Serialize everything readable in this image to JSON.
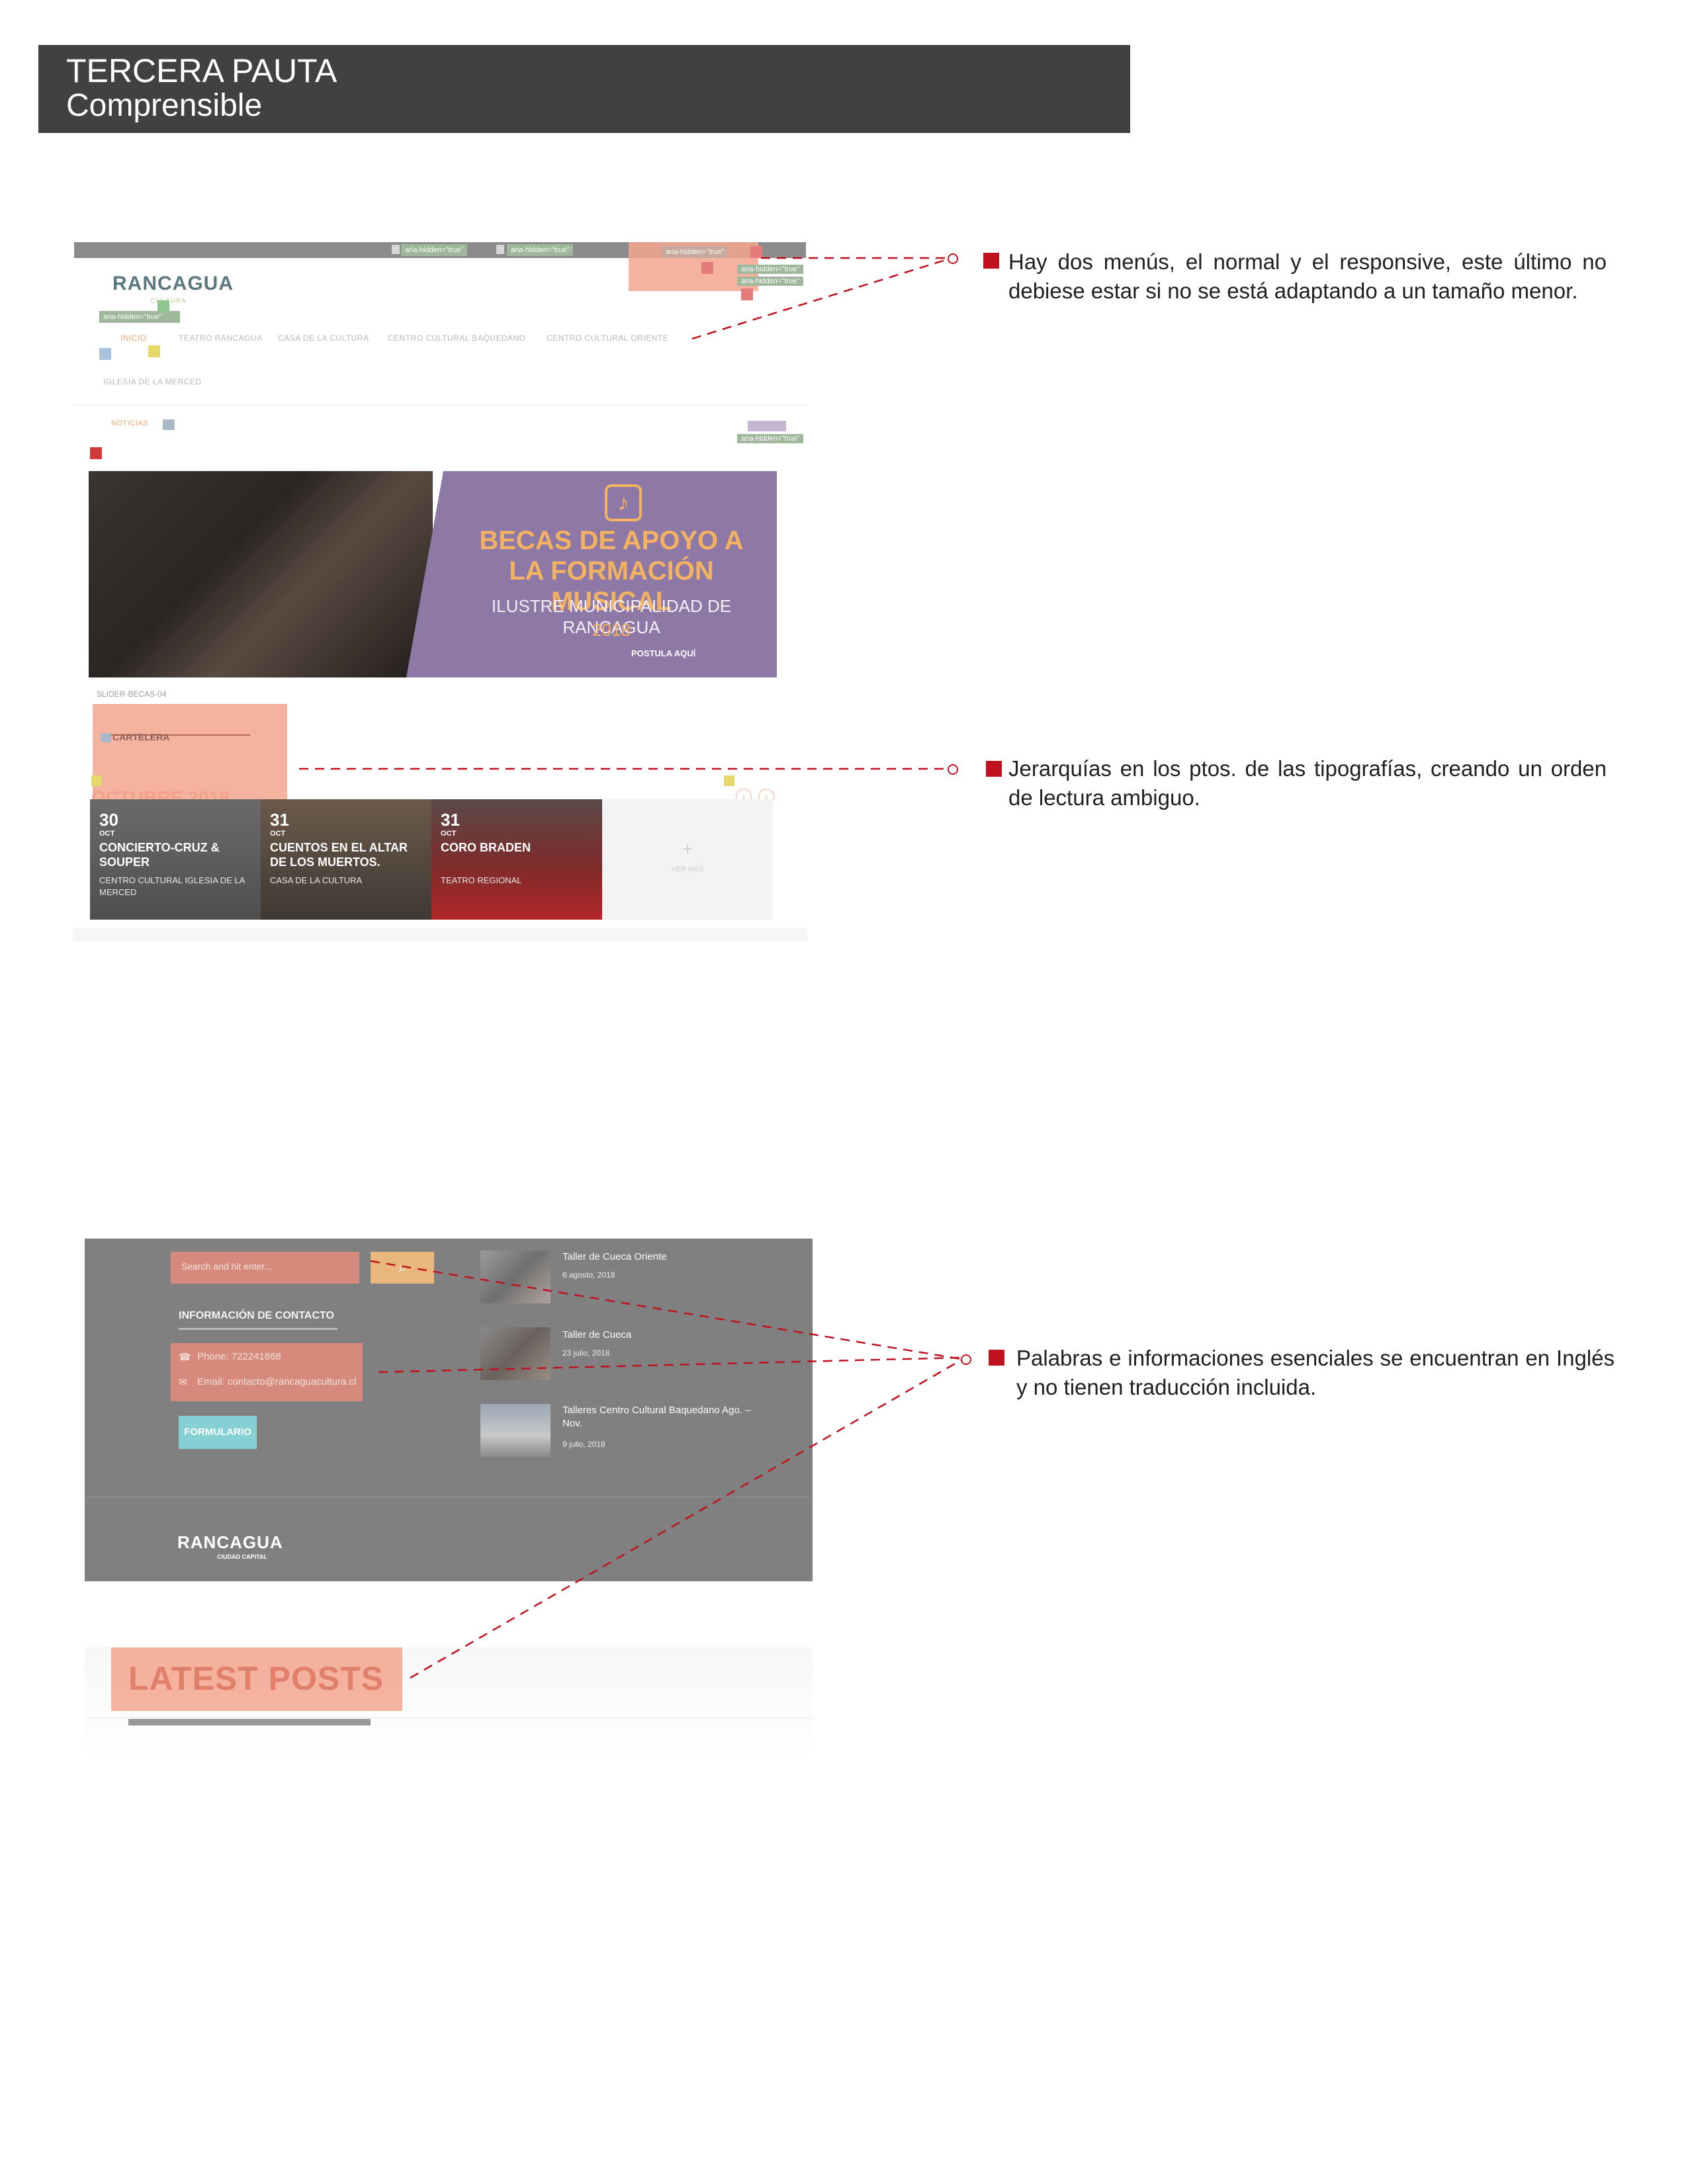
{
  "header": {
    "title": "TERCERA PAUTA",
    "subtitle": "Comprensible"
  },
  "annotations": [
    {
      "text": "Hay dos menús, el normal y el responsive, este último no debiese estar si no se está adaptando a un tamaño menor."
    },
    {
      "text": "Jerarquías en los ptos. de las tipografías, creando un orden de lectura ambiguo."
    },
    {
      "text": "Palabras e informaciones esenciales se encuentran en Inglés y no tienen traducción incluida."
    }
  ],
  "colors": {
    "header_bg": "#414141",
    "accent_red": "#c0111f",
    "highlight": "#f3a48e"
  },
  "site": {
    "logo": "RANCAGUA",
    "logo_sub": "CULTURA",
    "aria_tag": "aria-hidden=\"true\"",
    "menu": [
      "INICIO",
      "TEATRO RANCAGUA",
      "CASA DE LA CULTURA",
      "CENTRO CULTURAL BAQUEDANO",
      "CENTRO CULTURAL ORIENTE",
      "IGLESIA DE LA MERCED"
    ],
    "noticias": "NOTICIAS",
    "hero": {
      "title": "BECAS DE APOYO A LA FORMACIÓN MUSICAL",
      "subtitle": "ILUSTRE MUNICIPALIDAD DE RANCAGUA",
      "year": "2018",
      "cta": "POSTULA AQUÍ"
    },
    "slider_caption": "SLIDER-BECAS-04",
    "cartelera": "CARTELERA",
    "month_heading": "OCTUBRE 2018",
    "events": [
      {
        "day": "30",
        "month": "OCT",
        "title": "CONCIERTO-CRUZ & SOUPER",
        "place": "CENTRO CULTURAL IGLESIA DE LA MERCED"
      },
      {
        "day": "31",
        "month": "OCT",
        "title": "CUENTOS EN EL ALTAR DE LOS MUERTOS.",
        "place": "CASA DE LA CULTURA"
      },
      {
        "day": "31",
        "month": "OCT",
        "title": "CORO BRADEN",
        "place": "TEATRO REGIONAL"
      }
    ],
    "ver_mas": "VER MÁS",
    "plus": "+"
  },
  "footer": {
    "search_placeholder": "Search and hit enter...",
    "search_icon": "search-icon",
    "info_heading": "INFORMACIÓN DE CONTACTO",
    "phone": "Phone: 722241868",
    "email": "Email: contacto@rancaguacultura.cl",
    "form_button": "FORMULARIO",
    "posts": [
      {
        "title": "Taller de Cueca Oriente",
        "date": "6 agosto, 2018"
      },
      {
        "title": "Taller de Cueca",
        "date": "23 julio, 2018"
      },
      {
        "title": "Talleres Centro Cultural Baquedano Ago. – Nov.",
        "date": "9 julio, 2018"
      }
    ],
    "logo": "RANCAGUA",
    "logo_sub": "CIUDAD CAPITAL"
  },
  "latest": {
    "title": "LATEST POSTS"
  }
}
